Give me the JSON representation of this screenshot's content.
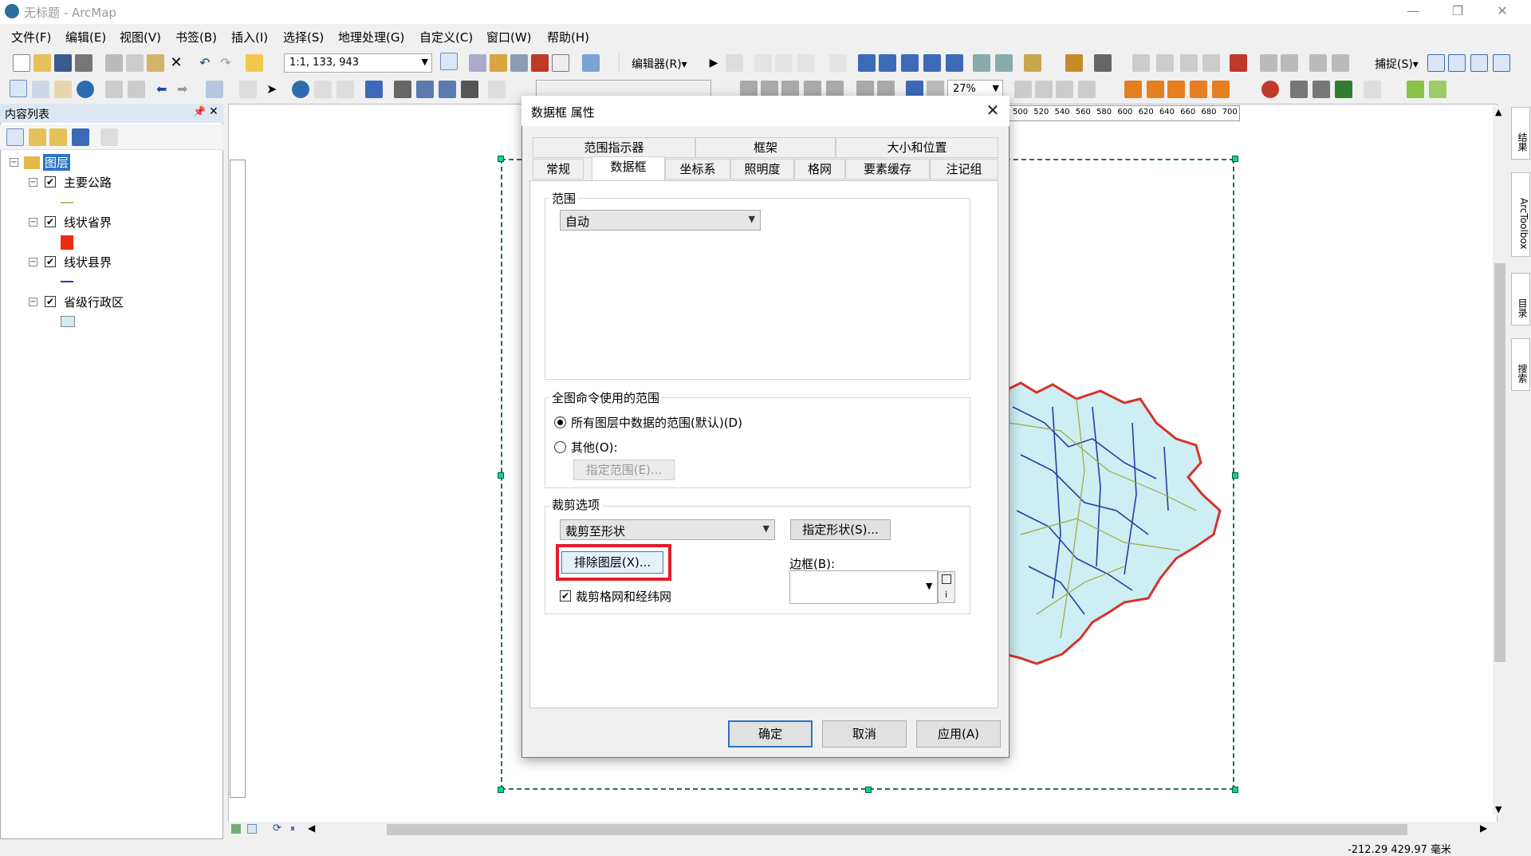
{
  "window": {
    "title": "无标题 - ArcMap"
  },
  "menubar": {
    "items": [
      "文件(F)",
      "编辑(E)",
      "视图(V)",
      "书签(B)",
      "插入(I)",
      "选择(S)",
      "地理处理(G)",
      "自定义(C)",
      "窗口(W)",
      "帮助(H)"
    ]
  },
  "toolbar": {
    "scale": "1:1, 133, 943",
    "editor_label": "编辑器(R)▾",
    "snap_label": "捕捉(S)▾",
    "zoom": "27%"
  },
  "toc": {
    "title": "内容列表",
    "root": "图层",
    "layers": [
      {
        "name": "主要公路",
        "checked": true,
        "symbol_color": "#b7c46a",
        "symbol": "line"
      },
      {
        "name": "线状省界",
        "checked": true,
        "symbol_color": "#ee2a12",
        "symbol": "square"
      },
      {
        "name": "线状县界",
        "checked": true,
        "symbol_color": "#2a3aa8",
        "symbol": "line"
      },
      {
        "name": "省级行政区",
        "checked": true,
        "symbol_color": "#cdeef2",
        "symbol": "rect"
      }
    ]
  },
  "ruler": {
    "top_ticks": "500 520 540 560 580 600 620 640 660 680 700"
  },
  "status": {
    "coords": "-212.29  429.97 毫米"
  },
  "right_dock": {
    "tabs": [
      "结果",
      "ArcToolbox",
      "目录",
      "搜索"
    ]
  },
  "dialog": {
    "title": "数据框 属性",
    "tabs_row1": [
      "范围指示器",
      "框架",
      "大小和位置"
    ],
    "tabs_row2": [
      "常规",
      "数据框",
      "坐标系",
      "照明度",
      "格网",
      "要素缓存",
      "注记组"
    ],
    "active_tab": "数据框",
    "extent_group": {
      "label": "范围",
      "value": "自动"
    },
    "full_extent_group": {
      "label": "全图命令使用的范围",
      "option_all": "所有图层中数据的范围(默认)(D)",
      "option_other": "其他(O):",
      "specify_button": "指定范围(E)..."
    },
    "clip_group": {
      "label": "裁剪选项",
      "clip_value": "裁剪至形状",
      "specify_shape_button": "指定形状(S)...",
      "exclude_layers_button": "排除图层(X)...",
      "border_label": "边框(B):",
      "clip_grids_label": "裁剪格网和经纬网",
      "clip_grids_checked": true
    },
    "buttons": {
      "ok": "确定",
      "cancel": "取消",
      "apply": "应用(A)"
    }
  },
  "colors": {
    "highlight": "#e21d2c",
    "map_fill": "#cdeef2",
    "border_red": "#d6322a"
  }
}
